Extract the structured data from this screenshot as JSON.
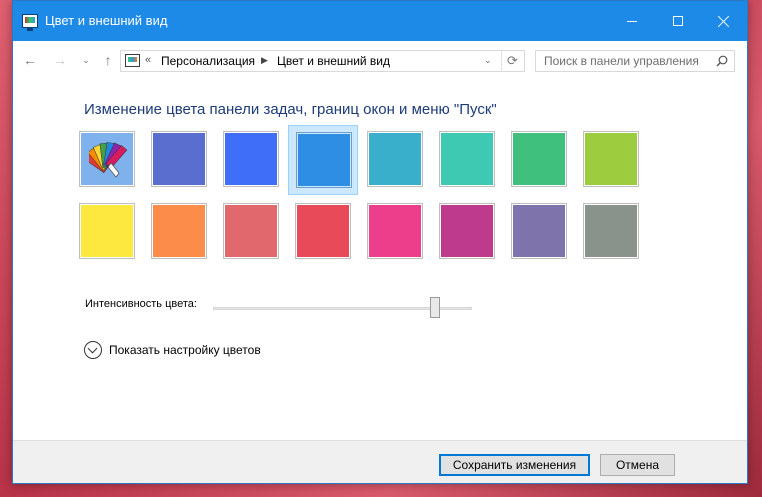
{
  "window": {
    "title": "Цвет и внешний вид"
  },
  "nav": {
    "back": "←",
    "forward": "→",
    "dropdown": "⌄",
    "up": "↑",
    "breadcrumb_prefix": "«",
    "breadcrumb_sep": "▶",
    "breadcrumb": [
      "Персонализация",
      "Цвет и внешний вид"
    ],
    "address_dropdown": "⌄",
    "refresh": "⟳",
    "search_placeholder": "Поиск в панели управления"
  },
  "main": {
    "heading": "Изменение цвета панели задач, границ окон и меню \"Пуск\"",
    "selected_index": 3,
    "swatches_row1": [
      {
        "name": "automatic",
        "color": "#7fb2ec"
      },
      {
        "name": "indigo",
        "color": "#5a6ed0"
      },
      {
        "name": "blue",
        "color": "#3f6ff9"
      },
      {
        "name": "sky",
        "color": "#2d8ee3"
      },
      {
        "name": "teal",
        "color": "#3aafcb"
      },
      {
        "name": "aqua",
        "color": "#3ec9b2"
      },
      {
        "name": "green",
        "color": "#3fc07c"
      },
      {
        "name": "lime",
        "color": "#9dcd3e"
      }
    ],
    "swatches_row2": [
      {
        "name": "yellow",
        "color": "#fde83f"
      },
      {
        "name": "orange",
        "color": "#fb8c49"
      },
      {
        "name": "salmon",
        "color": "#e1686c"
      },
      {
        "name": "red",
        "color": "#e84a59"
      },
      {
        "name": "pink",
        "color": "#ec3e8a"
      },
      {
        "name": "magenta",
        "color": "#bd3a8c"
      },
      {
        "name": "lavender",
        "color": "#7e74ab"
      },
      {
        "name": "gray",
        "color": "#8a938b"
      }
    ],
    "intensity_label": "Интенсивность цвета:",
    "intensity_value": 0.87,
    "expander_label": "Показать настройку цветов"
  },
  "footer": {
    "save_label": "Сохранить изменения",
    "cancel_label": "Отмена"
  }
}
